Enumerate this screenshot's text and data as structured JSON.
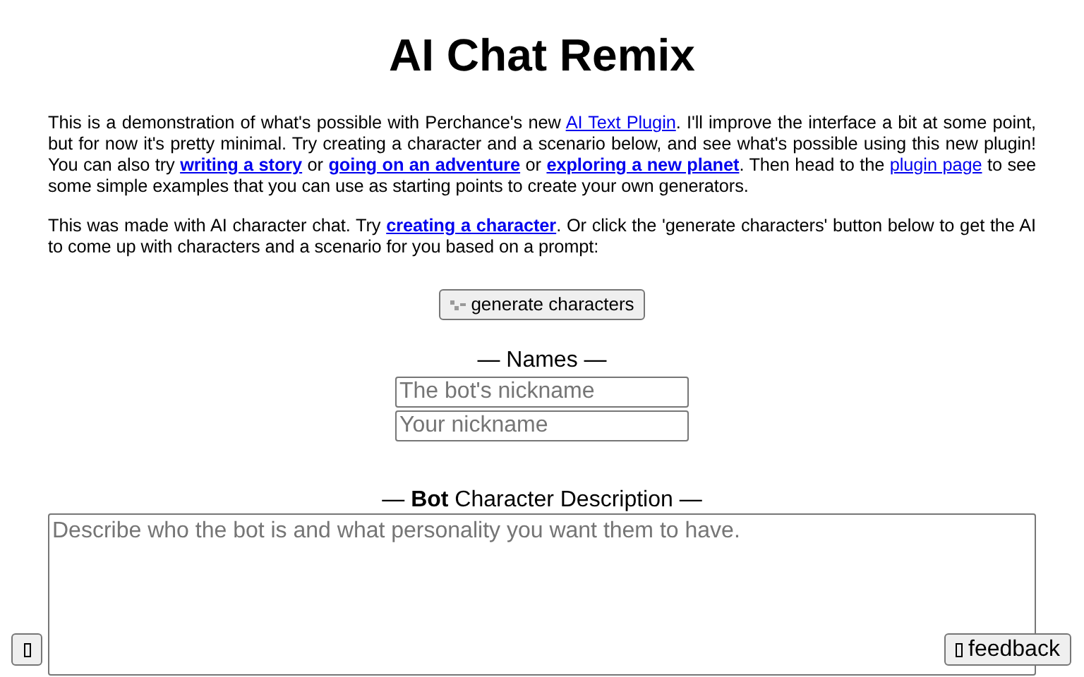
{
  "title": "AI Chat Remix",
  "paragraphs": [
    [
      {
        "text": "This is a demonstration of what's possible with Perchance's new "
      },
      {
        "text": "AI Text Plugin",
        "link": true,
        "bold": false
      },
      {
        "text": ". I'll improve the interface a bit at some point, but for now it's pretty minimal. Try creating a character and a scenario below, and see what's possible using this new plugin! You can also try "
      },
      {
        "text": "writing a story",
        "link": true,
        "bold": true
      },
      {
        "text": " or "
      },
      {
        "text": "going on an adventure",
        "link": true,
        "bold": true
      },
      {
        "text": " or "
      },
      {
        "text": "exploring a new planet",
        "link": true,
        "bold": true
      },
      {
        "text": ". Then head to the "
      },
      {
        "text": "plugin page",
        "link": true,
        "bold": false
      },
      {
        "text": " to see some simple examples that you can use as starting points to create your own generators."
      }
    ],
    [
      {
        "text": "This was made with AI character chat. Try "
      },
      {
        "text": "creating a character",
        "link": true,
        "bold": true
      },
      {
        "text": ". Or click the 'generate characters' button below to get the AI to come up with characters and a scenario for you based on a prompt:"
      }
    ]
  ],
  "generate_button": {
    "label": "generate characters"
  },
  "names_label": "— Names —",
  "name_fields": [
    {
      "placeholder": "The bot's nickname"
    },
    {
      "placeholder": "Your nickname"
    }
  ],
  "description_label": "— **Bot** Character Description —",
  "description_field": {
    "placeholder": "Describe who the bot is and what personality you want them to have."
  },
  "feedback_button": {
    "label": "feedback"
  }
}
